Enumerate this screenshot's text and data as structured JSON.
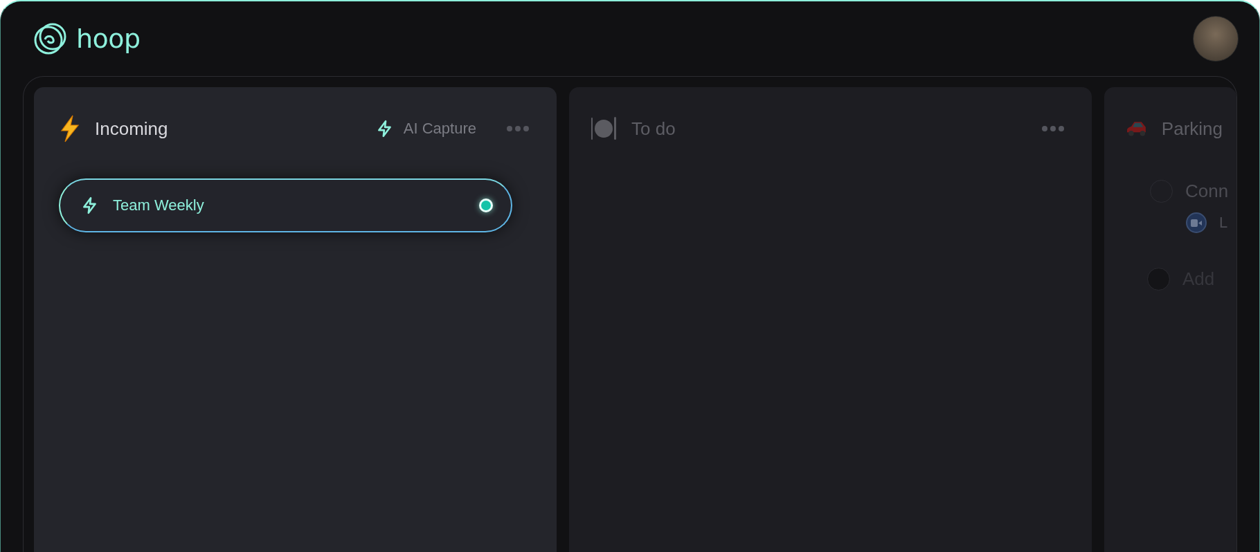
{
  "app": {
    "logo_text": "hoop"
  },
  "columns": [
    {
      "kind": "incoming",
      "title": "Incoming",
      "selected": true,
      "ai_capture": {
        "label": "AI Capture"
      },
      "more_menu": true,
      "items": [
        {
          "kind": "capture",
          "title": "Team Weekly",
          "live": true
        }
      ]
    },
    {
      "kind": "todo",
      "title": "To do",
      "selected": false,
      "more_menu": true
    },
    {
      "kind": "parking",
      "title": "Parking",
      "selected": false,
      "items": [
        {
          "kind": "task",
          "title": "Conn",
          "children": [
            {
              "kind": "meeting",
              "title": "L"
            }
          ]
        },
        {
          "kind": "add",
          "title": "Add"
        }
      ]
    }
  ]
}
